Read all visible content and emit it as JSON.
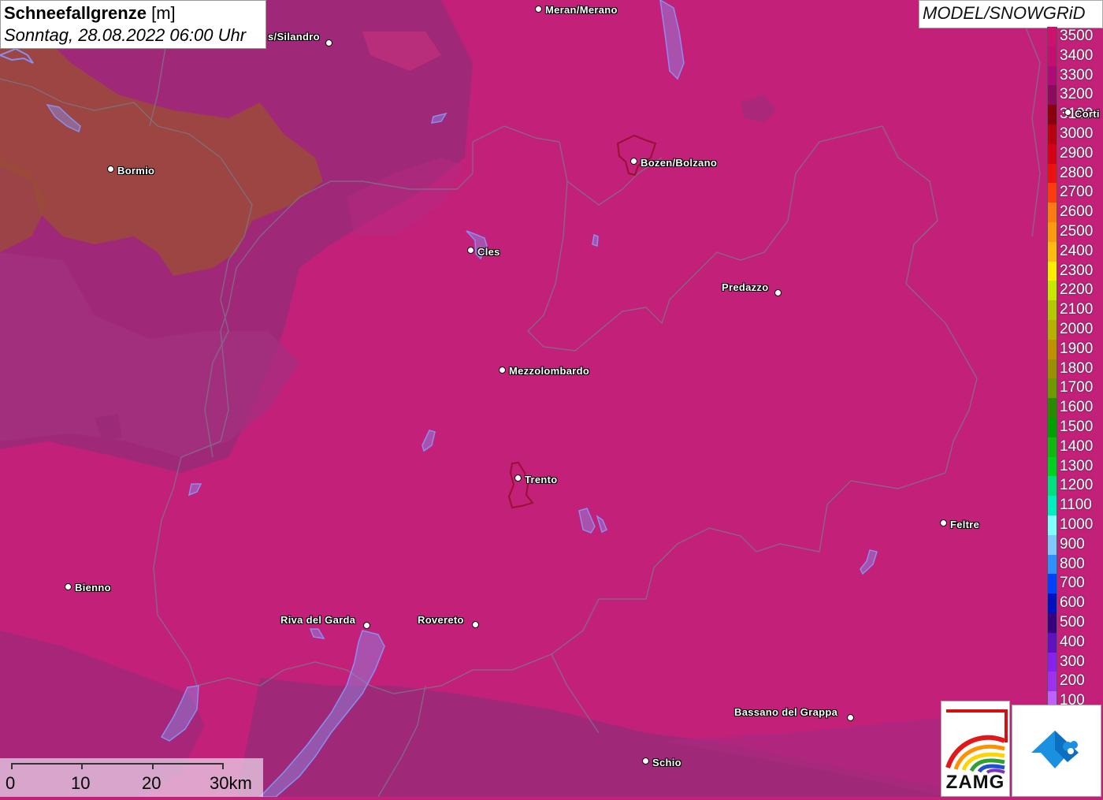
{
  "header": {
    "title": "Schneefallgrenze",
    "unit": "[m]",
    "subtitle": "Sonntag, 28.08.2022 06:00 Uhr"
  },
  "model_label": "MODEL/SNOWGRiD",
  "legend": {
    "entries": [
      {
        "label": "3500",
        "color": "#d0106e"
      },
      {
        "label": "3400",
        "color": "#c40f70"
      },
      {
        "label": "3300",
        "color": "#b00a78"
      },
      {
        "label": "3200",
        "color": "#8e0a5e"
      },
      {
        "label": "3100",
        "color": "#8b0010"
      },
      {
        "label": "3000",
        "color": "#b80010"
      },
      {
        "label": "2900",
        "color": "#d80018"
      },
      {
        "label": "2800",
        "color": "#ee1010"
      },
      {
        "label": "2700",
        "color": "#ff3a10"
      },
      {
        "label": "2600",
        "color": "#ff7a10"
      },
      {
        "label": "2500",
        "color": "#ff9a10"
      },
      {
        "label": "2400",
        "color": "#ffbb10"
      },
      {
        "label": "2300",
        "color": "#ffee00"
      },
      {
        "label": "2200",
        "color": "#c8e800"
      },
      {
        "label": "2100",
        "color": "#b6c800"
      },
      {
        "label": "2000",
        "color": "#b8b000"
      },
      {
        "label": "1900",
        "color": "#c09000"
      },
      {
        "label": "1800",
        "color": "#9a9000"
      },
      {
        "label": "1700",
        "color": "#6e9a00"
      },
      {
        "label": "1600",
        "color": "#2a8a00"
      },
      {
        "label": "1500",
        "color": "#00a000"
      },
      {
        "label": "1400",
        "color": "#10b810"
      },
      {
        "label": "1300",
        "color": "#00d020"
      },
      {
        "label": "1200",
        "color": "#00e080"
      },
      {
        "label": "1100",
        "color": "#00eec0"
      },
      {
        "label": "1000",
        "color": "#80ffff"
      },
      {
        "label": "900",
        "color": "#80c8ff"
      },
      {
        "label": "800",
        "color": "#3090ff"
      },
      {
        "label": "700",
        "color": "#0040ff"
      },
      {
        "label": "600",
        "color": "#0010c0"
      },
      {
        "label": "500",
        "color": "#380080"
      },
      {
        "label": "400",
        "color": "#6010c0"
      },
      {
        "label": "300",
        "color": "#8820ee"
      },
      {
        "label": "200",
        "color": "#a030f0"
      },
      {
        "label": "100",
        "color": "#c060ff"
      }
    ]
  },
  "cities": [
    {
      "name": "Meran/Merano"
    },
    {
      "name": "s/Silandro"
    },
    {
      "name": "Bormio"
    },
    {
      "name": "Bozen/Bolzano"
    },
    {
      "name": "Cles"
    },
    {
      "name": "Predazzo"
    },
    {
      "name": "Mezzolombardo"
    },
    {
      "name": "Trento"
    },
    {
      "name": "Feltre"
    },
    {
      "name": "Bienno"
    },
    {
      "name": "Riva del Garda"
    },
    {
      "name": "Rovereto"
    },
    {
      "name": "Bassano del Grappa"
    },
    {
      "name": "Schio"
    },
    {
      "name": "Corti"
    }
  ],
  "scale_bar": {
    "labels": [
      "0",
      "10",
      "20",
      "30km"
    ]
  },
  "logos": {
    "zamg": "ZAMG"
  },
  "colors": {
    "background": "#c3207a",
    "high_zone": "#a02870",
    "very_high_zone": "#8a3060",
    "peak_zone": "#9b4030"
  }
}
